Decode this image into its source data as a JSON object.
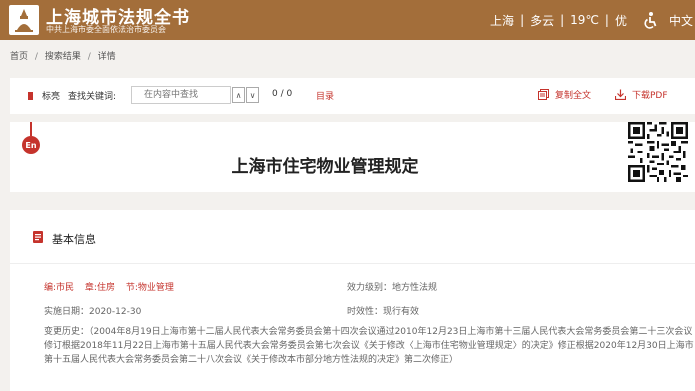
{
  "header": {
    "title": "上海城市法规全书",
    "subtitle": "中共上海市委全面依法治市委员会",
    "city": "上海",
    "weather": "多云",
    "temperature": "19℃",
    "air_quality": "优",
    "separator": "|",
    "language": "中文",
    "colors": {
      "background": "#a36e3a",
      "text": "#ffffff"
    }
  },
  "breadcrumb": {
    "items": [
      "首页",
      "搜索结果",
      "详情"
    ],
    "separator": "/"
  },
  "toolbar": {
    "biao_label": "标亮",
    "keyword_label": "查找关键词:",
    "search_placeholder": "在内容中查找",
    "up_arrow": "∧",
    "down_arrow": "∨",
    "match_count": "0 / 0",
    "toc_label": "目录",
    "copy_label": "复制全文",
    "download_label": "下载PDF",
    "accent_color": "#c5332c"
  },
  "document": {
    "title": "上海市住宅物业管理规定",
    "lang_badge": "En"
  },
  "basic_info": {
    "heading": "基本信息",
    "categories": [
      "编:市民",
      "章:住房",
      "节:物业管理"
    ],
    "effect_level": "效力级别：地方性法规",
    "implementation_date": "实施日期：2020-12-30",
    "validity": "时效性：现行有效",
    "history": "变更历史：（2004年8月19日上海市第十二届人民代表大会常务委员会第十四次会议通过2010年12月23日上海市第十三届人民代表大会常务委员会第二十三次会议修订根据2018年11月22日上海市第十五届人民代表大会常务委员会第七次会议《关于修改〈上海市住宅物业管理规定〉的决定》修正根据2020年12月30日上海市第十五届人民代表大会常务委员会第二十八次会议《关于修改本市部分地方性法规的决定》第二次修正）"
  }
}
